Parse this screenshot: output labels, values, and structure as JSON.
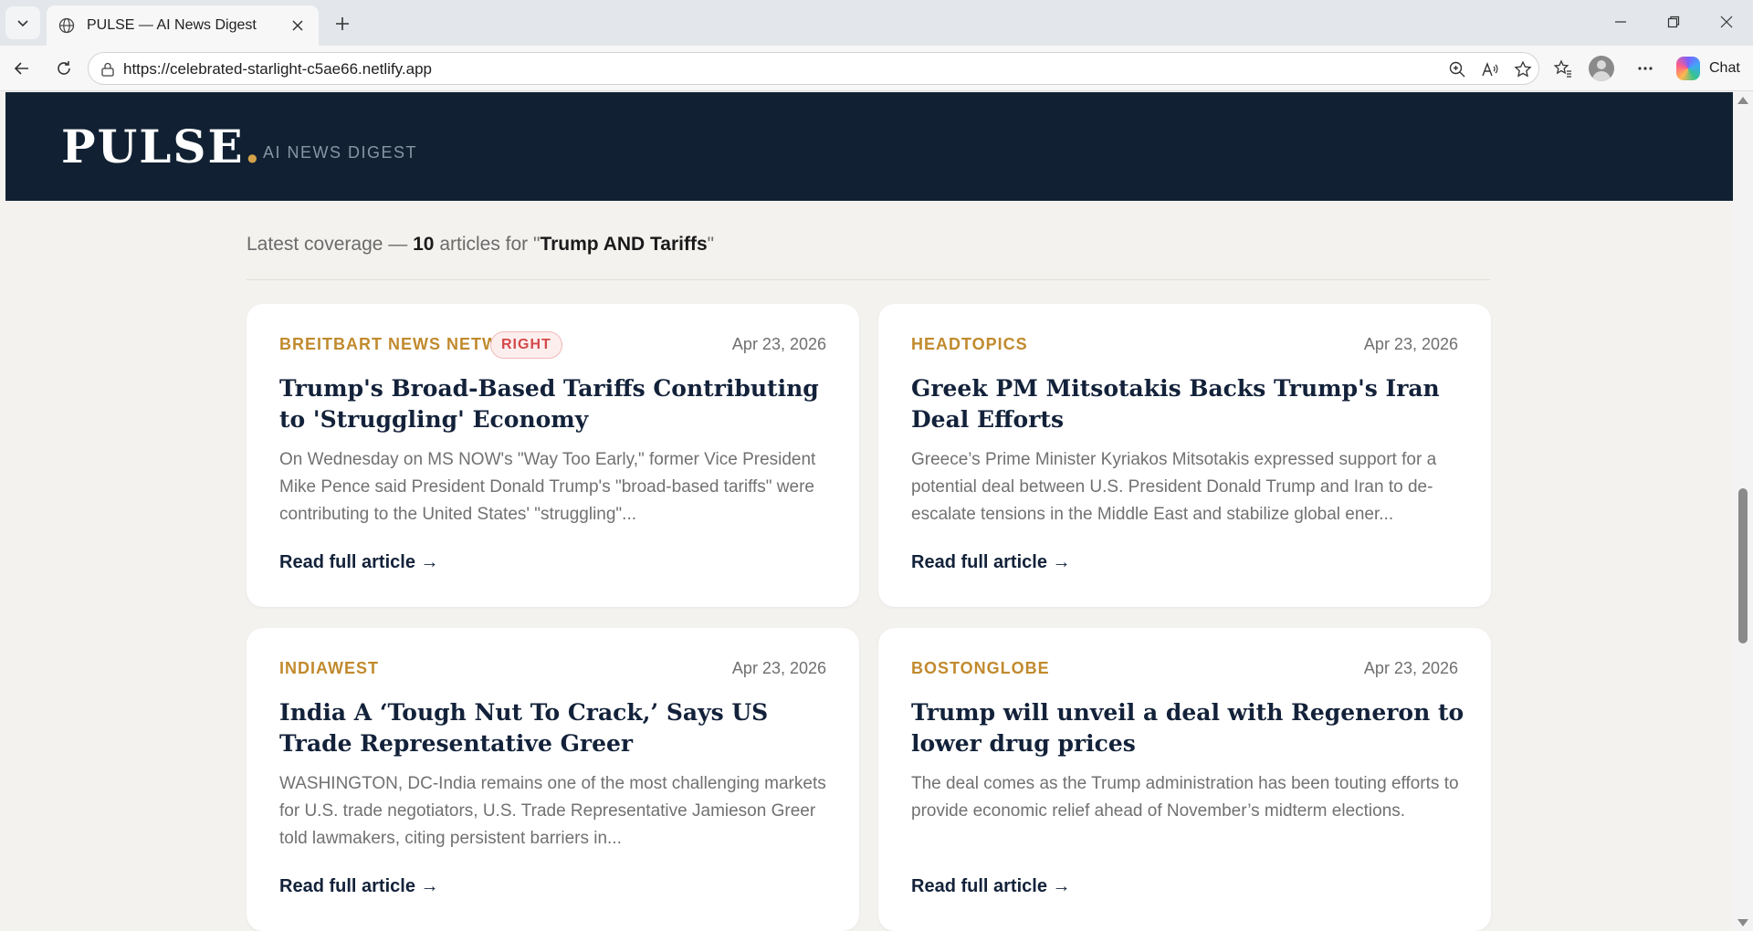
{
  "browser": {
    "tab_title": "PULSE — AI News Digest",
    "url": "https://celebrated-starlight-c5ae66.netlify.app",
    "chat_label": "Chat"
  },
  "site": {
    "logo": "PULSE",
    "logo_dot": ".",
    "tagline": "AI NEWS DIGEST"
  },
  "coverage": {
    "prefix": "Latest coverage —",
    "count": "10",
    "middle": "articles for \"",
    "query": "Trump AND Tariffs",
    "suffix": "\""
  },
  "articles": [
    {
      "source": "BREITBART NEWS NETWORK",
      "lean": "RIGHT",
      "date": "Apr 23, 2026",
      "title": "Trump's Broad-Based Tariffs Contributing to 'Struggling' Economy",
      "summary": "On Wednesday on MS NOW's \"Way Too Early,\" former Vice President Mike Pence said President Donald Trump's \"broad-based tariffs\" were contributing to the United States' \"struggling\"...",
      "link": "Read full article →"
    },
    {
      "source": "HEADTOPICS",
      "date": "Apr 23, 2026",
      "title": "Greek PM Mitsotakis Backs Trump's Iran Deal Efforts",
      "summary": "Greece’s Prime Minister Kyriakos Mitsotakis expressed support for a potential deal between U.S. President Donald Trump and Iran to de-escalate tensions in the Middle East and stabilize global ener...",
      "link": "Read full article →"
    },
    {
      "source": "INDIAWEST",
      "date": "Apr 23, 2026",
      "title": "India A ‘Tough Nut To Crack,’ Says US Trade Representative Greer",
      "summary": "WASHINGTON, DC-India remains one of the most challenging markets for U.S. trade negotiators, U.S. Trade Representative Jamieson Greer told lawmakers, citing persistent barriers in...",
      "link": "Read full article →"
    },
    {
      "source": "BOSTONGLOBE",
      "date": "Apr 23, 2026",
      "title": "Trump will unveil a deal with Regeneron to lower drug prices",
      "summary": "The deal comes as the Trump administration has been touting efforts to provide economic relief ahead of November’s midterm elections.",
      "link": "Read full article →"
    }
  ],
  "colors": {
    "header_bg": "#112133",
    "accent": "#d4a24b",
    "source_label": "#c18a2e",
    "lean_right": "#d4494a",
    "page_bg": "#f3f2ef"
  }
}
